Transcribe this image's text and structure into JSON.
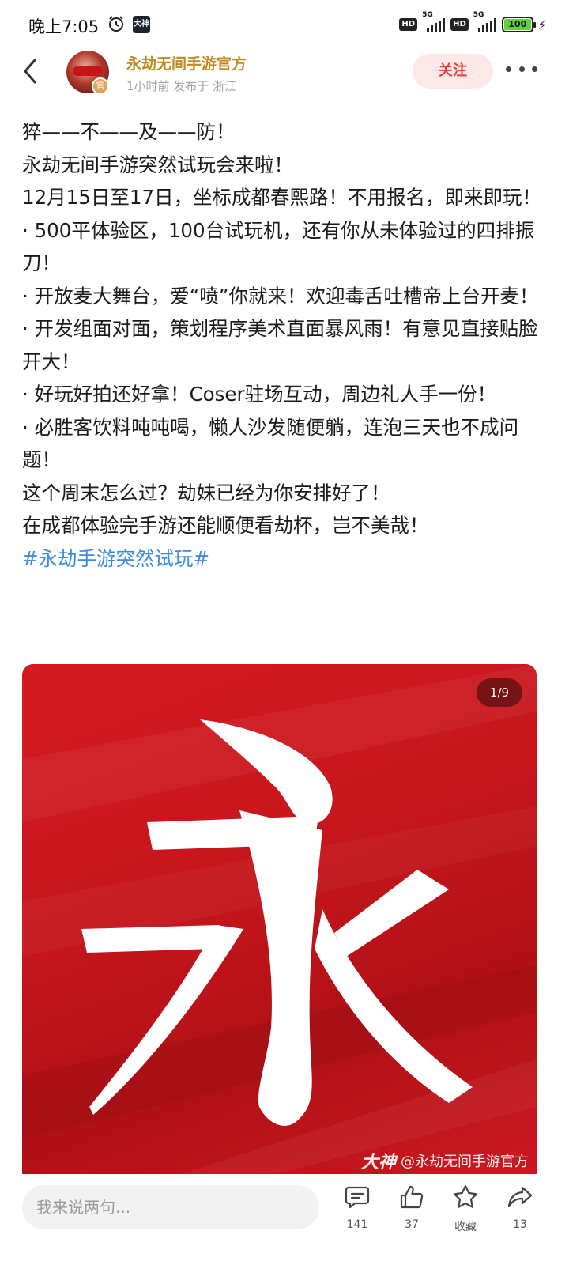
{
  "status_bar": {
    "time": "晚上7:05",
    "app_badge": "大神",
    "hd_1": "HD",
    "net_1": "5G",
    "hd_2": "HD",
    "net_2": "5G",
    "battery": "100"
  },
  "header": {
    "author_name": "永劫无间手游官方",
    "official_badge": "官",
    "post_meta": "1小时前 发布于 浙江",
    "follow_label": "关注"
  },
  "post": {
    "lines": [
      "猝——不——及——防！",
      "永劫无间手游突然试玩会来啦！",
      "12月15日至17日，坐标成都春熙路！不用报名，即来即玩！",
      "·  500平体验区，100台试玩机，还有你从未体验过的四排振刀！",
      "·  开放麦大舞台，爱“喷”你就来！欢迎毒舌吐槽帝上台开麦！",
      "·  开发组面对面，策划程序美术直面暴风雨！有意见直接贴脸开大！",
      "·  好玩好拍还好拿！Coser驻场互动，周边礼人手一份！",
      "·  必胜客饮料吨吨喝，懒人沙发随便躺，连泡三天也不成问题！",
      "这个周末怎么过？劫妹已经为你安排好了！",
      "在成都体验完手游还能顺便看劫杯，岂不美哉！"
    ],
    "hashtag": "#永劫手游突然试玩#"
  },
  "image": {
    "page_indicator": "1/9",
    "glyph": "永",
    "watermark_logo": "大神",
    "watermark_text": "@永劫无间手游官方",
    "background_color": "#c8161d"
  },
  "bottom_bar": {
    "comment_placeholder": "我来说两句...",
    "comment_count": "141",
    "like_count": "37",
    "favorite_label": "收藏",
    "share_count": "13"
  },
  "colors": {
    "accent_red": "#e53c3c",
    "author_gold": "#c28a1e",
    "hashtag_blue": "#3b8be6"
  }
}
